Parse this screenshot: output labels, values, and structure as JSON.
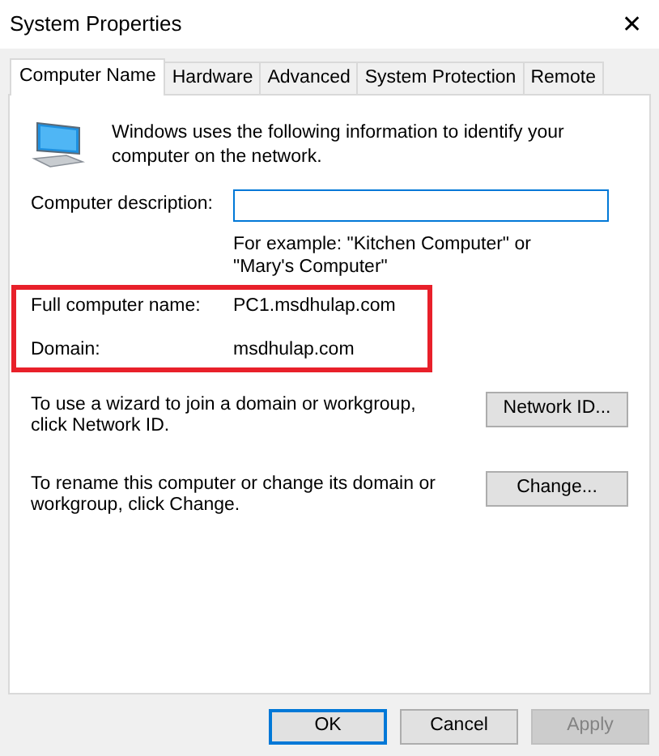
{
  "window": {
    "title": "System Properties",
    "close": "✕"
  },
  "tabs": [
    {
      "label": "Computer Name",
      "selected": true
    },
    {
      "label": "Hardware",
      "selected": false
    },
    {
      "label": "Advanced",
      "selected": false
    },
    {
      "label": "System Protection",
      "selected": false
    },
    {
      "label": "Remote",
      "selected": false
    }
  ],
  "intro": "Windows uses the following information to identify your computer on the network.",
  "description": {
    "label": "Computer description:",
    "hint": "For example: \"Kitchen Computer\" or \"Mary's Computer\""
  },
  "info": [
    {
      "label": "Full computer name:",
      "value": "PC1.msdhulap.com"
    },
    {
      "label": "Domain:",
      "value": "msdhulap.com"
    }
  ],
  "actions": [
    {
      "text": "To use a wizard to join a domain or workgroup, click Network ID.",
      "button": "Network ID..."
    },
    {
      "text": "To rename this computer or change its domain or workgroup, click Change.",
      "button": "Change..."
    }
  ],
  "buttons": [
    {
      "label": "OK",
      "default": true,
      "disabled": false
    },
    {
      "label": "Cancel",
      "default": false,
      "disabled": false
    },
    {
      "label": "Apply",
      "default": false,
      "disabled": true
    }
  ]
}
